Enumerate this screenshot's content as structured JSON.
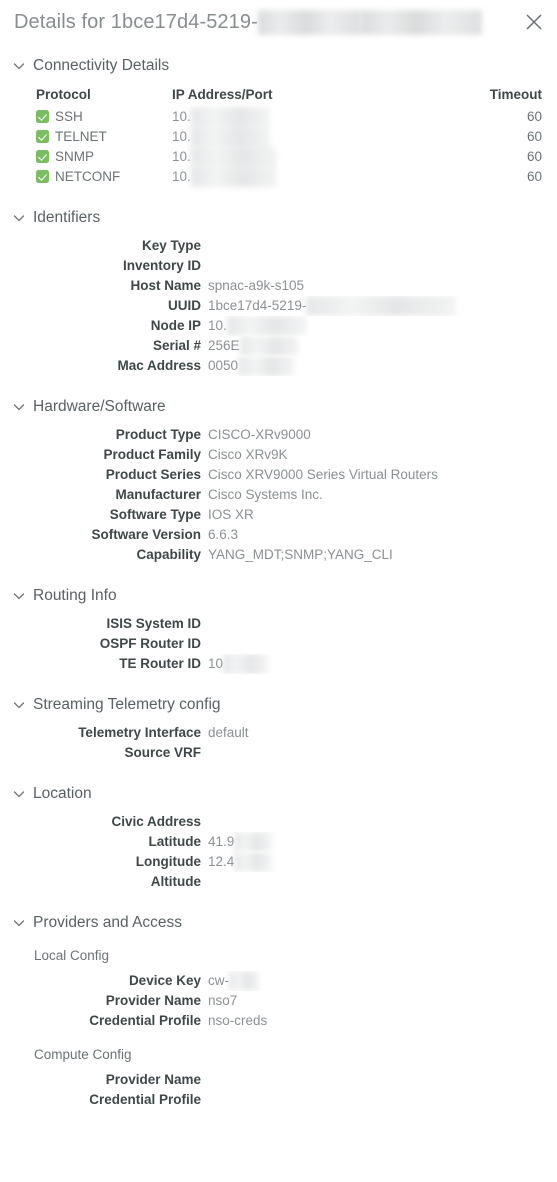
{
  "header": {
    "title_prefix": "Details for 1bce17d4-5219-",
    "title_redacted_1": "4d97-b80e-",
    "title_redacted_2": "611cf249f06a",
    "close_label": "Close"
  },
  "sections": {
    "connectivity": {
      "title": "Connectivity Details",
      "columns": [
        "Protocol",
        "IP Address/Port",
        "Timeout"
      ],
      "rows": [
        {
          "checked": true,
          "protocol": "SSH",
          "ip_prefix": "10.",
          "ip_redacted": "10.10.100.20",
          "timeout": "60"
        },
        {
          "checked": true,
          "protocol": "TELNET",
          "ip_prefix": "10.",
          "ip_redacted": "10.10.100.23",
          "timeout": "60"
        },
        {
          "checked": true,
          "protocol": "SNMP",
          "ip_prefix": "10.",
          "ip_redacted": "10.10.100.161",
          "timeout": "60"
        },
        {
          "checked": true,
          "protocol": "NETCONF",
          "ip_prefix": "10.",
          "ip_redacted": "10.10.100.830",
          "timeout": "60"
        }
      ]
    },
    "identifiers": {
      "title": "Identifiers",
      "rows": [
        {
          "label": "Key Type",
          "value": ""
        },
        {
          "label": "Inventory ID",
          "value": ""
        },
        {
          "label": "Host Name",
          "value": "spnac-a9k-s105"
        },
        {
          "label": "UUID",
          "value": "1bce17d4-5219-",
          "redacted": "4d97-b80e-611cf249f06a"
        },
        {
          "label": "Node IP",
          "value": "10.",
          "redacted": "10.10.100.20"
        },
        {
          "label": "Serial #",
          "value": "256E",
          "redacted": "AB1C4F5"
        },
        {
          "label": "Mac Address",
          "value": "0050",
          "redacted": "56ab4f80"
        }
      ]
    },
    "hardware": {
      "title": "Hardware/Software",
      "rows": [
        {
          "label": "Product Type",
          "value": "CISCO-XRv9000"
        },
        {
          "label": "Product Family",
          "value": "Cisco XRv9K"
        },
        {
          "label": "Product Series",
          "value": "Cisco XRV9000 Series Virtual Routers"
        },
        {
          "label": "Manufacturer",
          "value": "Cisco Systems Inc."
        },
        {
          "label": "Software Type",
          "value": "IOS XR"
        },
        {
          "label": "Software Version",
          "value": "6.6.3"
        },
        {
          "label": "Capability",
          "value": "YANG_MDT;SNMP;YANG_CLI"
        }
      ]
    },
    "routing": {
      "title": "Routing Info",
      "rows": [
        {
          "label": "ISIS System ID",
          "value": ""
        },
        {
          "label": "OSPF Router ID",
          "value": ""
        },
        {
          "label": "TE Router ID",
          "value": "10",
          "redacted": ".10.100"
        }
      ]
    },
    "telemetry": {
      "title": "Streaming Telemetry config",
      "rows": [
        {
          "label": "Telemetry Interface",
          "value": "default"
        },
        {
          "label": "Source VRF",
          "value": ""
        }
      ]
    },
    "location": {
      "title": "Location",
      "rows": [
        {
          "label": "Civic Address",
          "value": ""
        },
        {
          "label": "Latitude",
          "value": "41.9",
          "redacted": "02782"
        },
        {
          "label": "Longitude",
          "value": "12.4",
          "redacted": "96366"
        },
        {
          "label": "Altitude",
          "value": ""
        }
      ]
    },
    "providers": {
      "title": "Providers and Access",
      "local_config_title": "Local Config",
      "local_rows": [
        {
          "label": "Device Key",
          "value": "cw-",
          "redacted": "1234"
        },
        {
          "label": "Provider Name",
          "value": "nso7"
        },
        {
          "label": "Credential Profile",
          "value": "nso-creds"
        }
      ],
      "compute_config_title": "Compute Config",
      "compute_rows": [
        {
          "label": "Provider Name",
          "value": ""
        },
        {
          "label": "Credential Profile",
          "value": ""
        }
      ]
    }
  },
  "colors": {
    "checkbox_green": "#7bbd63",
    "label_text": "#3f4749",
    "value_text": "#8b9093",
    "section_title": "#5a6164",
    "panel_title": "#888d8f",
    "background": "#ffffff"
  }
}
